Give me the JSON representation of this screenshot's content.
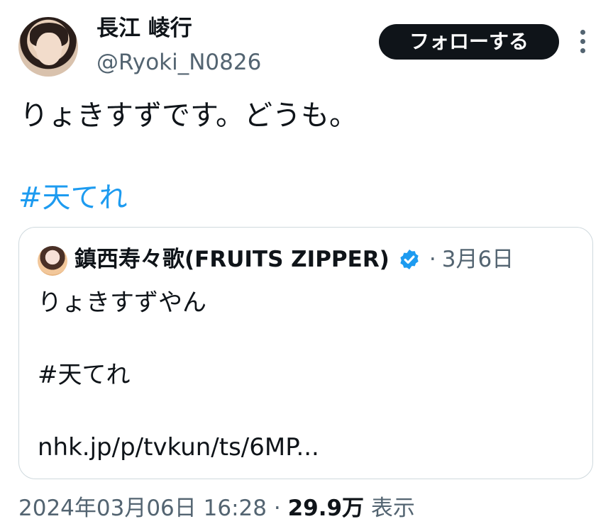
{
  "author": {
    "display_name": "長江 崚行",
    "handle": "@Ryoki_N0826",
    "avatar_icon": "profile-photo"
  },
  "follow_button_label": "フォローする",
  "more_icon": "more-vertical-icon",
  "tweet": {
    "text": "りょきすずです。どうも。",
    "hashtag": "#天てれ"
  },
  "quoted_tweet": {
    "author_name": "鎮西寿々歌(FRUITS ZIPPER)",
    "verified": true,
    "separator": "·",
    "date": "3月6日",
    "lines": [
      "りょきすずやん",
      "#天てれ",
      "nhk.jp/p/tvkun/ts/6MP..."
    ]
  },
  "meta": {
    "timestamp": "2024年03月06日 16:28",
    "separator": "·",
    "views_count": "29.9万",
    "views_label": "表示"
  },
  "colors": {
    "link": "#1d9bf0",
    "text": "#0f1419",
    "secondary": "#536471",
    "button_bg": "#0f1419",
    "border": "#cfd9de"
  }
}
